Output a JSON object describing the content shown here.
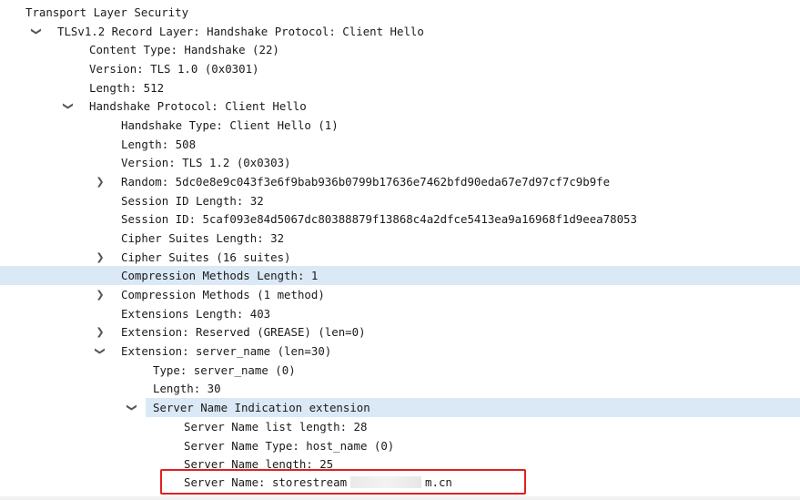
{
  "tree": {
    "rows": [
      {
        "text": "Transport Layer Security",
        "expanded": true
      },
      {
        "text": "TLSv1.2 Record Layer: Handshake Protocol: Client Hello",
        "expanded": true
      },
      {
        "text": "Content Type: Handshake (22)"
      },
      {
        "text": "Version: TLS 1.0 (0x0301)"
      },
      {
        "text": "Length: 512"
      },
      {
        "text": "Handshake Protocol: Client Hello",
        "expanded": true
      },
      {
        "text": "Handshake Type: Client Hello (1)"
      },
      {
        "text": "Length: 508"
      },
      {
        "text": "Version: TLS 1.2 (0x0303)"
      },
      {
        "text": "Random: 5dc0e8e9c043f3e6f9bab936b0799b17636e7462bfd90eda67e7d97cf7c9b9fe",
        "expanded": false
      },
      {
        "text": "Session ID Length: 32"
      },
      {
        "text": "Session ID: 5caf093e84d5067dc80388879f13868c4a2dfce5413ea9a16968f1d9eea78053"
      },
      {
        "text": "Cipher Suites Length: 32"
      },
      {
        "text": "Cipher Suites (16 suites)",
        "expanded": false
      },
      {
        "text": "Compression Methods Length: 1",
        "selected": true
      },
      {
        "text": "Compression Methods (1 method)",
        "expanded": false
      },
      {
        "text": "Extensions Length: 403"
      },
      {
        "text": "Extension: Reserved (GREASE) (len=0)",
        "expanded": false
      },
      {
        "text": "Extension: server_name (len=30)",
        "expanded": true
      },
      {
        "text": "Type: server_name (0)"
      },
      {
        "text": "Length: 30"
      },
      {
        "text": "Server Name Indication extension",
        "expanded": true,
        "selected": true
      },
      {
        "text": "Server Name list length: 28"
      },
      {
        "text": "Server Name Type: host_name (0)"
      },
      {
        "text": "Server Name length: 25"
      },
      {
        "text_prefix": "Server Name: storestream",
        "text_suffix": "m.cn",
        "redacted": true
      }
    ]
  },
  "icons": {
    "expanded": "chevron-down-icon",
    "collapsed": "chevron-right-icon",
    "expanded_glyph": "❯",
    "collapsed_glyph": "❯"
  },
  "colors": {
    "selection": "#dbe9f6",
    "highlight_box": "#e02020",
    "text": "#1a1a1a"
  }
}
